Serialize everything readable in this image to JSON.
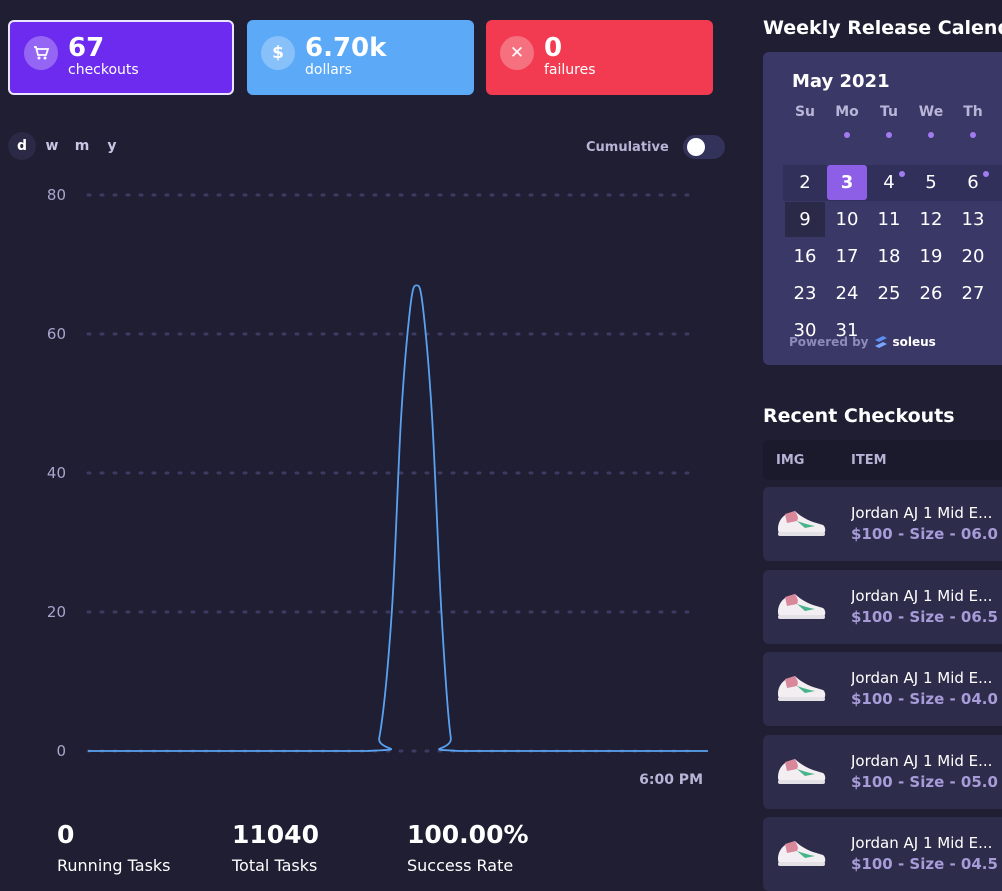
{
  "stats": {
    "checkouts": {
      "value": "67",
      "label": "checkouts",
      "color": "#6d2bef"
    },
    "dollars": {
      "value": "6.70k",
      "label": "dollars",
      "color": "#5ba9f7"
    },
    "failures": {
      "value": "0",
      "label": "failures",
      "color": "#f23b50"
    }
  },
  "range_tabs": [
    "d",
    "w",
    "m",
    "y"
  ],
  "active_range": "d",
  "cumulative": {
    "label": "Cumulative",
    "enabled": false
  },
  "chart_data": {
    "type": "line",
    "title": "",
    "xlabel": "",
    "ylabel": "",
    "yticks": [
      0,
      20,
      40,
      60,
      80
    ],
    "ylim": [
      0,
      80
    ],
    "x_tick_labels": [
      "6:00 PM"
    ],
    "grid": true,
    "series": [
      {
        "color": "#5aa2f0",
        "points": [
          [
            0.0,
            0
          ],
          [
            0.45,
            0
          ],
          [
            0.47,
            2
          ],
          [
            0.49,
            20
          ],
          [
            0.505,
            48
          ],
          [
            0.52,
            64
          ],
          [
            0.53,
            67
          ],
          [
            0.54,
            64
          ],
          [
            0.555,
            48
          ],
          [
            0.57,
            20
          ],
          [
            0.585,
            2
          ],
          [
            0.6,
            0
          ],
          [
            1.0,
            0
          ]
        ]
      }
    ]
  },
  "bottom_stats": [
    {
      "value": "0",
      "label": "Running Tasks"
    },
    {
      "value": "11040",
      "label": "Total Tasks"
    },
    {
      "value": "100.00%",
      "label": "Success Rate"
    }
  ],
  "calendar": {
    "title": "Weekly Release Calendar",
    "month": "May 2021",
    "dows": [
      "Su",
      "Mo",
      "Tu",
      "We",
      "Th"
    ],
    "weeks": [
      [
        "2",
        "3",
        "4",
        "5",
        "6"
      ],
      [
        "9",
        "10",
        "11",
        "12",
        "13"
      ],
      [
        "16",
        "17",
        "18",
        "19",
        "20"
      ],
      [
        "23",
        "24",
        "25",
        "26",
        "27"
      ],
      [
        "30",
        "31"
      ]
    ],
    "today": "3",
    "powered_by": "Powered by",
    "brand": "soleus"
  },
  "recent_checkouts": {
    "title": "Recent Checkouts",
    "col_img": "IMG",
    "col_item": "ITEM",
    "items": [
      {
        "name": "Jordan AJ 1 Mid E...",
        "meta": "$100 - Size - 06.0"
      },
      {
        "name": "Jordan AJ 1 Mid E...",
        "meta": "$100 - Size - 06.5"
      },
      {
        "name": "Jordan AJ 1 Mid E...",
        "meta": "$100 - Size - 04.0"
      },
      {
        "name": "Jordan AJ 1 Mid E...",
        "meta": "$100 - Size - 05.0"
      },
      {
        "name": "Jordan AJ 1 Mid E...",
        "meta": "$100 - Size - 04.5"
      }
    ]
  }
}
